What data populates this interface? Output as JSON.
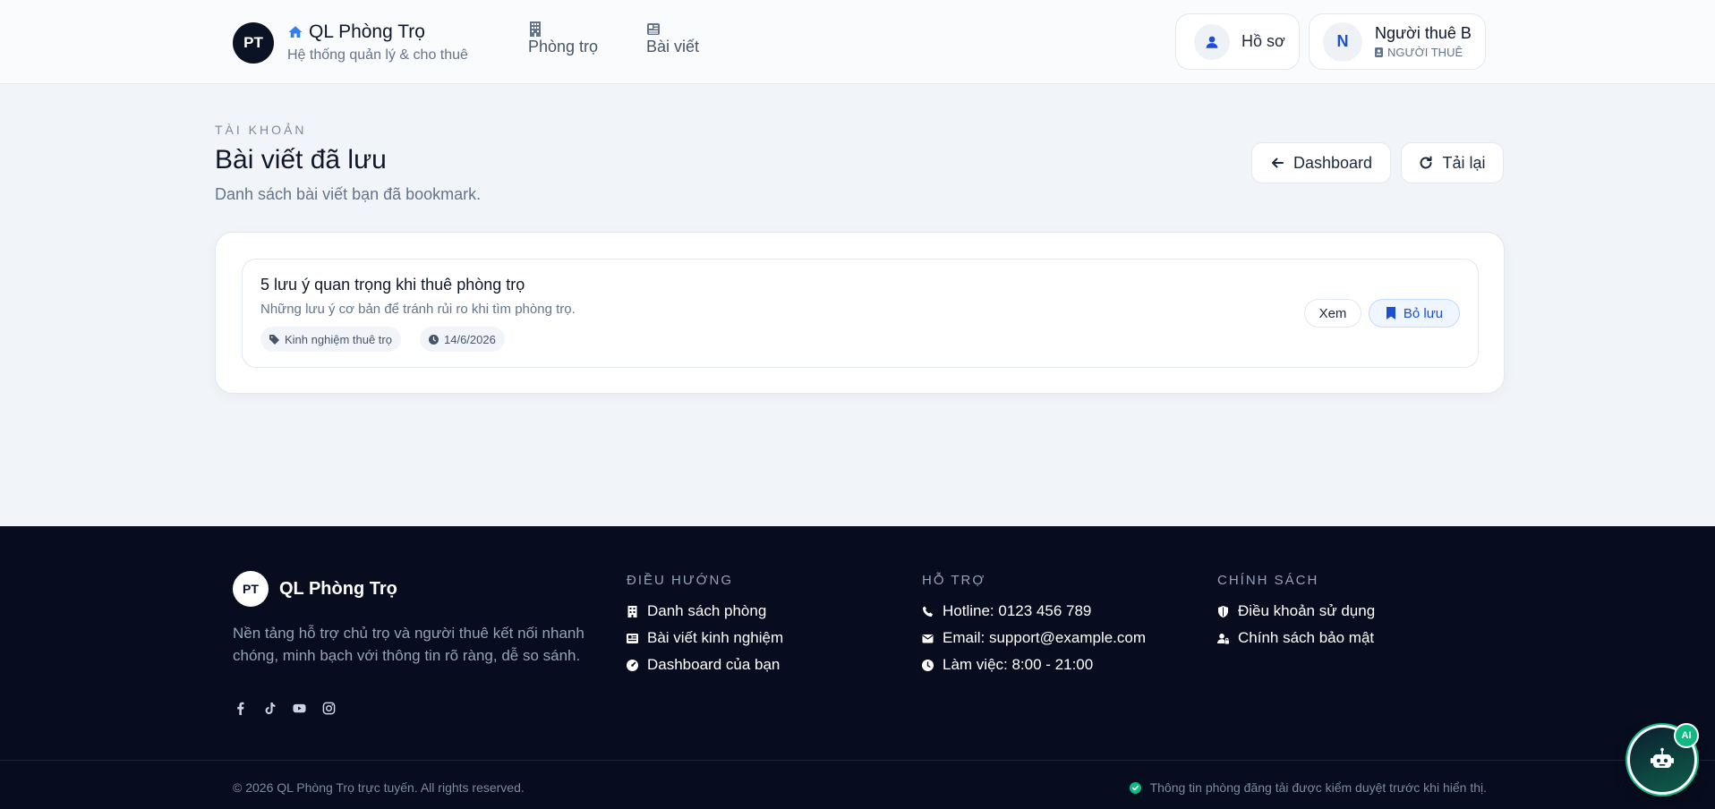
{
  "header": {
    "logo_initials": "PT",
    "brand_name": "QL Phòng Trọ",
    "brand_tagline": "Hệ thống quản lý & cho thuê",
    "nav": [
      {
        "label": "Phòng trọ",
        "icon": "building-icon"
      },
      {
        "label": "Bài viết",
        "icon": "newspaper-icon"
      }
    ],
    "profile_label": "Hồ sơ",
    "user_initial": "N",
    "user_name": "Người thuê B",
    "user_role": "NGƯỜI THUÊ"
  },
  "page": {
    "eyebrow": "TÀI KHOẢN",
    "title": "Bài viết đã lưu",
    "subtitle": "Danh sách bài viết bạn đã bookmark.",
    "dashboard_button": "Dashboard",
    "reload_button": "Tải lại"
  },
  "saved_posts": [
    {
      "title": "5 lưu ý quan trọng khi thuê phòng trọ",
      "description": "Những lưu ý cơ bản để tránh rủi ro khi tìm phòng trọ.",
      "category": "Kinh nghiệm thuê trọ",
      "date": "14/6/2026",
      "view_label": "Xem",
      "unsave_label": "Bỏ lưu"
    }
  ],
  "footer": {
    "logo_initials": "PT",
    "brand_name": "QL Phòng Trọ",
    "description": "Nền tảng hỗ trợ chủ trọ và người thuê kết nối nhanh chóng, minh bạch với thông tin rõ ràng, dễ so sánh.",
    "socials": [
      "facebook-icon",
      "tiktok-icon",
      "youtube-icon",
      "instagram-icon"
    ],
    "nav_heading": "ĐIỀU HƯỚNG",
    "nav_items": [
      "Danh sách phòng",
      "Bài viết kinh nghiệm",
      "Dashboard của bạn"
    ],
    "support_heading": "HỖ TRỢ",
    "support_items": [
      "Hotline: 0123 456 789",
      "Email: support@example.com",
      "Làm việc: 8:00 - 21:00"
    ],
    "policy_heading": "CHÍNH SÁCH",
    "policy_items": [
      "Điều khoản sử dụng",
      "Chính sách bảo mật"
    ],
    "copyright": "© 2026 QL Phòng Trọ trực tuyến. All rights reserved.",
    "notice": "Thông tin phòng đăng tải được kiểm duyệt trước khi hiển thị."
  },
  "ai_assistant": {
    "badge": "AI"
  },
  "colors": {
    "accent": "#1d4ed8",
    "dark": "#0b1224",
    "footer_bg": "#070c1f",
    "success": "#10b981"
  }
}
